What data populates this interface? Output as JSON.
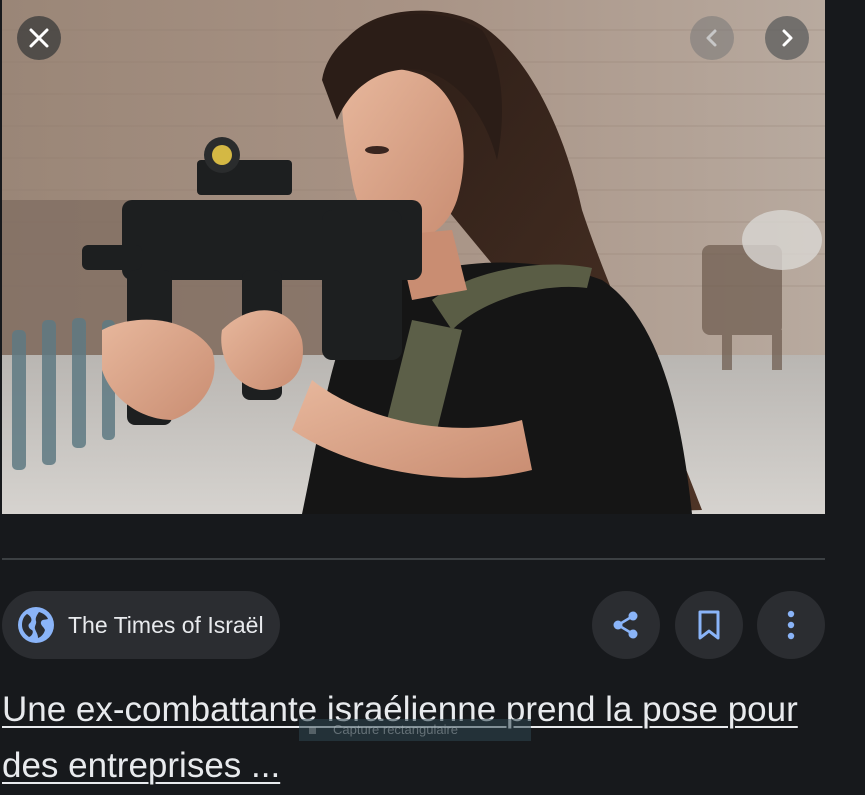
{
  "viewer": {
    "image_alt": "Photo: woman in black t-shirt aiming a compact submachine gun with red-dot sight",
    "close_icon": "close-icon",
    "prev_icon": "chevron-left-icon",
    "next_icon": "chevron-right-icon"
  },
  "source": {
    "name": "The Times of Israël",
    "icon": "globe-icon"
  },
  "actions": {
    "share_icon": "share-icon",
    "save_icon": "bookmark-icon",
    "more_icon": "more-vert-icon"
  },
  "result": {
    "title": "Une ex-combattante israélienne prend la pose pour des entreprises ..."
  },
  "overlay": {
    "capture_label": "Capture rectangulaire"
  },
  "colors": {
    "background": "#17191c",
    "chip": "#2b2d31",
    "accent_blue": "#8ab4f8",
    "text": "#e8eaed"
  }
}
